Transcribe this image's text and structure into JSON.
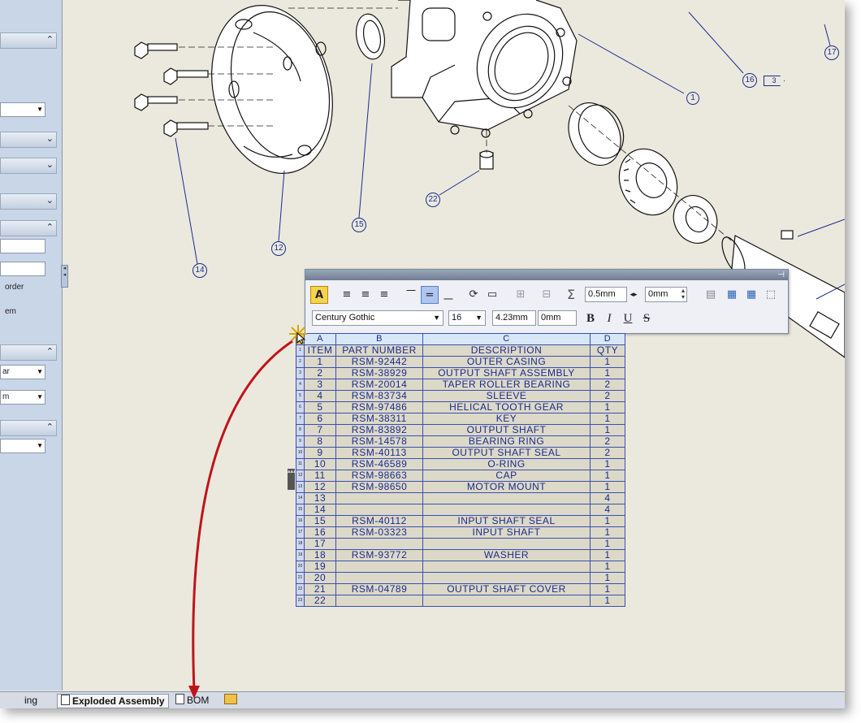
{
  "left_panel": {
    "text_order": "order",
    "text_em": "em",
    "select_mid_1": "ar",
    "select_mid_2": "m"
  },
  "callouts": [
    "1",
    "3",
    "12",
    "14",
    "15",
    "16",
    "17",
    "22"
  ],
  "toolbar": {
    "border_width": "0.5mm",
    "border_offset": "0mm",
    "font_name": "Century Gothic",
    "font_size": "16",
    "text_height": "4.23mm",
    "text_offset": "0mm",
    "bold_label": "B",
    "italic_label": "I",
    "underline_label": "U",
    "strike_label": "S",
    "sum_label": "Σ"
  },
  "bom": {
    "column_letters": [
      "A",
      "B",
      "C",
      "D"
    ],
    "headers": [
      "ITEM",
      "PART NUMBER",
      "DESCRIPTION",
      "QTY"
    ],
    "rows": [
      {
        "item": "1",
        "part": "RSM-92442",
        "desc": "OUTER CASING",
        "qty": "1"
      },
      {
        "item": "2",
        "part": "RSM-38929",
        "desc": "OUTPUT SHAFT ASSEMBLY",
        "qty": "1"
      },
      {
        "item": "3",
        "part": "RSM-20014",
        "desc": "TAPER ROLLER BEARING",
        "qty": "2"
      },
      {
        "item": "4",
        "part": "RSM-83734",
        "desc": "SLEEVE",
        "qty": "2"
      },
      {
        "item": "5",
        "part": "RSM-97486",
        "desc": "HELICAL TOOTH GEAR",
        "qty": "1"
      },
      {
        "item": "6",
        "part": "RSM-38311",
        "desc": "KEY",
        "qty": "1"
      },
      {
        "item": "7",
        "part": "RSM-83892",
        "desc": "OUTPUT SHAFT",
        "qty": "1"
      },
      {
        "item": "8",
        "part": "RSM-14578",
        "desc": "BEARING RING",
        "qty": "2"
      },
      {
        "item": "9",
        "part": "RSM-40113",
        "desc": "OUTPUT SHAFT SEAL",
        "qty": "2"
      },
      {
        "item": "10",
        "part": "RSM-46589",
        "desc": "O-RING",
        "qty": "1"
      },
      {
        "item": "11",
        "part": "RSM-98663",
        "desc": "CAP",
        "qty": "1"
      },
      {
        "item": "12",
        "part": "RSM-98650",
        "desc": "MOTOR MOUNT",
        "qty": "1"
      },
      {
        "item": "13",
        "part": "",
        "desc": "",
        "qty": "4"
      },
      {
        "item": "14",
        "part": "",
        "desc": "",
        "qty": "4"
      },
      {
        "item": "15",
        "part": "RSM-40112",
        "desc": "INPUT SHAFT SEAL",
        "qty": "1"
      },
      {
        "item": "16",
        "part": "RSM-03323",
        "desc": "INPUT SHAFT",
        "qty": "1"
      },
      {
        "item": "17",
        "part": "",
        "desc": "",
        "qty": "1"
      },
      {
        "item": "18",
        "part": "RSM-93772",
        "desc": "WASHER",
        "qty": "1"
      },
      {
        "item": "19",
        "part": "",
        "desc": "",
        "qty": "1"
      },
      {
        "item": "20",
        "part": "",
        "desc": "",
        "qty": "1"
      },
      {
        "item": "21",
        "part": "RSM-04789",
        "desc": "OUTPUT SHAFT COVER",
        "qty": "1"
      },
      {
        "item": "22",
        "part": "",
        "desc": "",
        "qty": "1"
      }
    ]
  },
  "tabs": {
    "partial": "ing",
    "exploded": "Exploded Assembly",
    "bom": "BOM"
  },
  "colors": {
    "drawing_bg": "#ebe9dd",
    "balloon": "#1a2b8f",
    "arrow": "#c0141b"
  }
}
